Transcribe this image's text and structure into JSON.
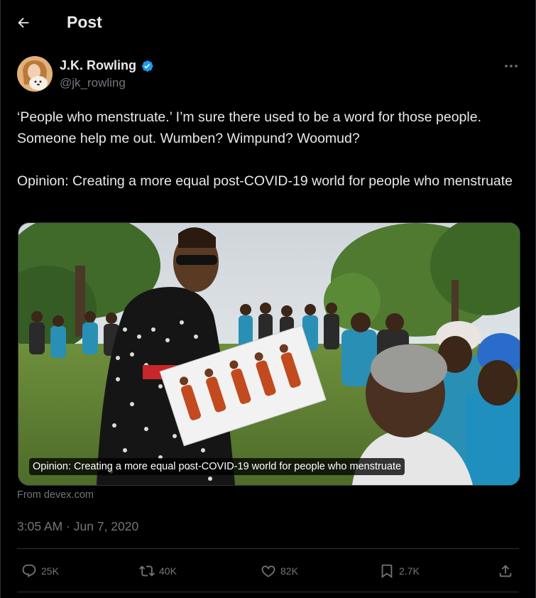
{
  "header": {
    "title": "Post"
  },
  "author": {
    "name": "J.K. Rowling",
    "handle": "@jk_rowling"
  },
  "tweet": {
    "line1": "‘People who menstruate.’ I’m sure there used to be a word for those people. Someone help me out. Wumben? Wimpund? Woomud?",
    "line2": "Opinion: Creating a more equal post-COVID-19 world for people who menstruate"
  },
  "card": {
    "caption": "Opinion: Creating a more equal post-COVID-19 world for people who menstruate",
    "source": "From devex.com"
  },
  "meta": {
    "timestamp": "3:05 AM · Jun 7, 2020"
  },
  "actions": {
    "replies": "25K",
    "reposts": "40K",
    "likes": "82K",
    "bookmarks": "2.7K"
  },
  "colors": {
    "verified": "#1d9bf0",
    "muted": "#71767b",
    "border": "#2f3336"
  },
  "icons": [
    "back-arrow-icon",
    "verified-badge-icon",
    "more-icon",
    "reply-icon",
    "repost-icon",
    "like-icon",
    "bookmark-icon",
    "share-icon"
  ]
}
